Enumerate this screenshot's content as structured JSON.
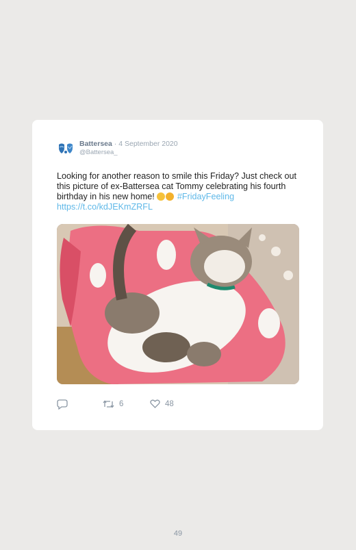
{
  "tweet": {
    "author_name": "Battersea",
    "separator": "·",
    "date": "4 September 2020",
    "handle": "@Battersea_",
    "text_before_emoji": "Looking for another reason to smile this Friday? Just check out this picture of ex-Battersea cat Tommy celebrating his fourth birthday in his new home! ",
    "emoji": [
      "rolling-on-floor-laughing-emoji",
      "heart-eyes-emoji"
    ],
    "hashtag": "#FridayFeeling",
    "link": "https://t.co/kdJEKmZRFL",
    "image_subject": "cat",
    "logo_icon": "battersea-logo-icon"
  },
  "actions": {
    "reply_icon": "reply-icon",
    "retweet_icon": "retweet-icon",
    "retweet_count": "6",
    "like_icon": "heart-icon",
    "like_count": "48"
  },
  "page": {
    "number": "49"
  },
  "colors": {
    "background": "#ebeae8",
    "card": "#ffffff",
    "link": "#5fb8e8",
    "muted": "#8a96a3",
    "author": "#6b7a8c",
    "logo_blue": "#2f73b5"
  }
}
